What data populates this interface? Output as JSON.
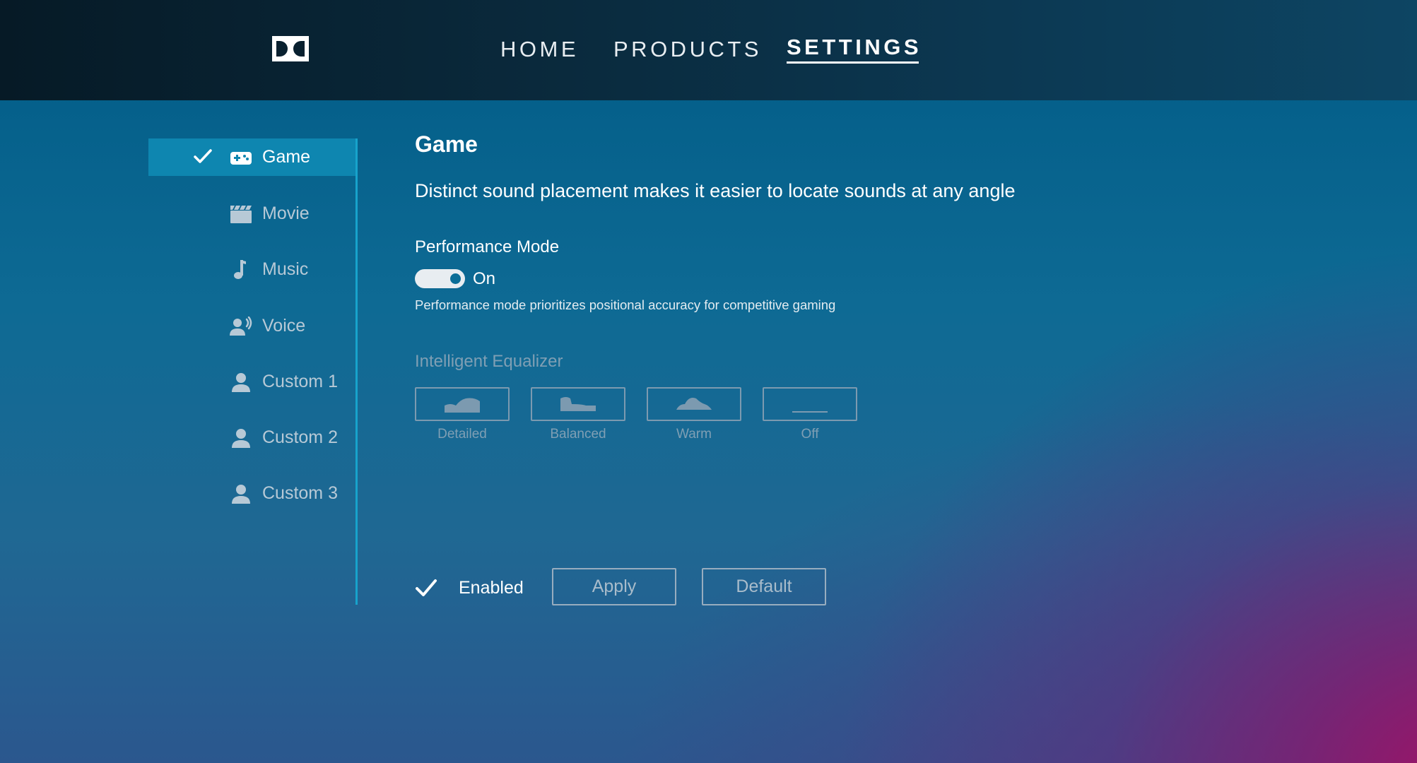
{
  "header": {
    "nav": [
      {
        "label": "HOME"
      },
      {
        "label": "PRODUCTS"
      },
      {
        "label": "SETTINGS"
      }
    ],
    "active_nav": "SETTINGS"
  },
  "sidebar": {
    "items": [
      {
        "label": "Game",
        "icon": "gamepad-icon",
        "active": true
      },
      {
        "label": "Movie",
        "icon": "clapperboard-icon"
      },
      {
        "label": "Music",
        "icon": "music-note-icon"
      },
      {
        "label": "Voice",
        "icon": "voice-icon"
      },
      {
        "label": "Custom 1",
        "icon": "user-icon"
      },
      {
        "label": "Custom 2",
        "icon": "user-icon"
      },
      {
        "label": "Custom 3",
        "icon": "user-icon"
      }
    ]
  },
  "main": {
    "title": "Game",
    "description": "Distinct sound placement makes it easier to locate sounds at any angle",
    "performance": {
      "label": "Performance Mode",
      "state": "On",
      "enabled": true,
      "hint": "Performance mode prioritizes positional accuracy for competitive gaming"
    },
    "equalizer": {
      "label": "Intelligent Equalizer",
      "options": [
        {
          "label": "Detailed",
          "icon": "eq-detailed-icon"
        },
        {
          "label": "Balanced",
          "icon": "eq-balanced-icon"
        },
        {
          "label": "Warm",
          "icon": "eq-warm-icon"
        },
        {
          "label": "Off",
          "icon": "eq-off-icon"
        }
      ]
    },
    "footer": {
      "enabled_label": "Enabled",
      "apply_label": "Apply",
      "default_label": "Default"
    }
  },
  "colors": {
    "accent": "#0e86b0",
    "sidebar_line": "#17a3cc",
    "header_bg": "#0a2a3d",
    "disabled_text": "#7f9fb4"
  }
}
